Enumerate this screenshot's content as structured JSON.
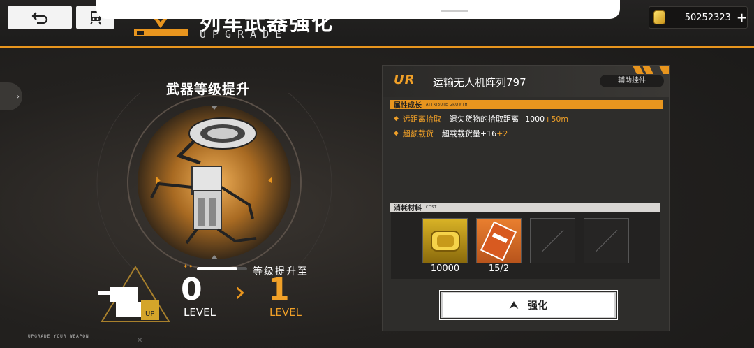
{
  "header": {
    "title_cn": "列车武器强化",
    "title_en": "UPGRADE",
    "currency_value": "50252323",
    "back_icon": "undo-arrow-icon",
    "train_icon": "train-icon",
    "plus_icon": "plus-icon"
  },
  "left": {
    "section_title": "武器等级提升",
    "level_up_label": "等级提升至",
    "progress_fraction": 0.8,
    "current_level": "0",
    "current_level_label": "LEVEL",
    "next_level": "1",
    "next_level_label": "LEVEL",
    "footer_text": "UPGRADE YOUR WEAPON",
    "turret_badge": "UP"
  },
  "panel": {
    "rarity": "UR",
    "item_name": "运输无人机阵列797",
    "type_tag": "辅助挂件",
    "attr_section_cn": "属性成长",
    "attr_section_en": "ATTRIBUTE GROWTH",
    "attributes": [
      {
        "name": "远距离拾取",
        "desc": "遗失货物的拾取距离+1000",
        "bonus": "+50m"
      },
      {
        "name": "超额载货",
        "desc": "超载载货量+16",
        "bonus": "+2"
      }
    ],
    "cost_section_cn": "消耗材料",
    "cost_section_en": "COST",
    "costs": [
      {
        "count": "10000",
        "icon": "gold-coin-icon"
      },
      {
        "count": "15/2",
        "icon": "upgrade-ticket-icon"
      }
    ],
    "upgrade_button": "强化"
  },
  "colors": {
    "accent": "#e8951e",
    "level_next": "#f0a028",
    "panel_bg": "#2e2d2b"
  }
}
